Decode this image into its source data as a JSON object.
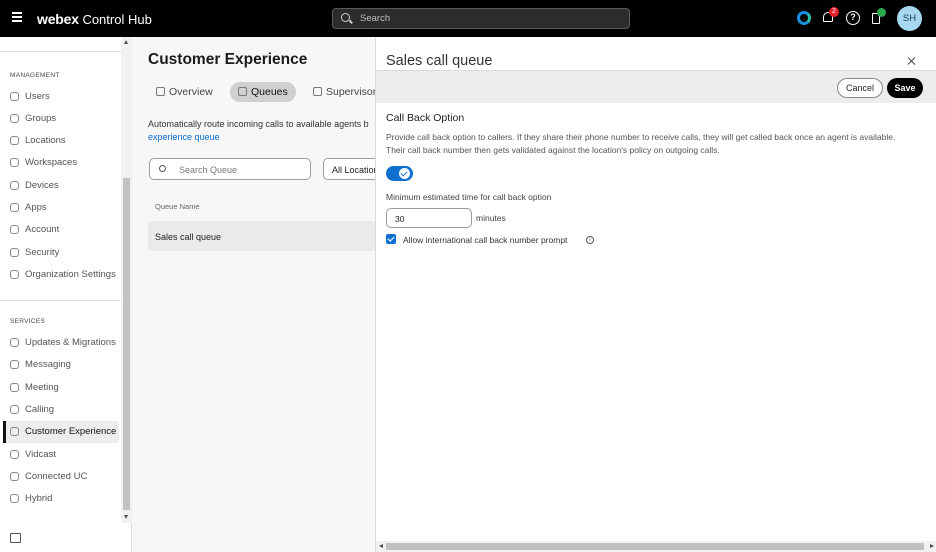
{
  "app": {
    "brand_bold": "webex",
    "brand_rest": "Control Hub"
  },
  "topbar": {
    "search_placeholder": "Search",
    "notifications_count": "2",
    "avatar_initials": "SH"
  },
  "sidebar": {
    "management_heading": "MANAGEMENT",
    "management_items": [
      {
        "label": "Users",
        "icon": "user-icon"
      },
      {
        "label": "Groups",
        "icon": "groups-icon"
      },
      {
        "label": "Locations",
        "icon": "location-icon"
      },
      {
        "label": "Workspaces",
        "icon": "workspace-icon"
      },
      {
        "label": "Devices",
        "icon": "device-icon"
      },
      {
        "label": "Apps",
        "icon": "apps-icon"
      },
      {
        "label": "Account",
        "icon": "account-icon"
      },
      {
        "label": "Security",
        "icon": "security-icon"
      },
      {
        "label": "Organization Settings",
        "icon": "settings-icon"
      }
    ],
    "services_heading": "SERVICES",
    "services_items": [
      {
        "label": "Updates & Migrations",
        "icon": "refresh-icon"
      },
      {
        "label": "Messaging",
        "icon": "message-icon"
      },
      {
        "label": "Meeting",
        "icon": "meeting-icon"
      },
      {
        "label": "Calling",
        "icon": "phone-icon"
      },
      {
        "label": "Customer Experience",
        "icon": "customer-experience-icon"
      },
      {
        "label": "Vidcast",
        "icon": "play-icon"
      },
      {
        "label": "Connected UC",
        "icon": "connected-uc-icon"
      },
      {
        "label": "Hybrid",
        "icon": "cloud-icon"
      }
    ]
  },
  "main": {
    "title": "Customer Experience",
    "tabs": [
      {
        "label": "Overview"
      },
      {
        "label": "Queues"
      },
      {
        "label": "Supervisor"
      }
    ],
    "description_line1": "Automatically route incoming calls to available agents b",
    "description_link": "experience queue",
    "search_placeholder": "Search Queue",
    "location_filter": "All Locations",
    "column_header": "Queue Name",
    "rows": [
      {
        "name": "Sales call queue"
      }
    ]
  },
  "panel": {
    "title": "Sales call queue",
    "cancel_label": "Cancel",
    "save_label": "Save",
    "section_title": "Call Back Option",
    "description": "Provide call back option to callers. If they share their phone number to receive calls, they will get called back once an agent is available. Their call back number then gets validated against the location's policy on outgoing calls.",
    "toggle_on": true,
    "min_time_label": "Minimum estimated time for call back option",
    "min_time_value": "30",
    "min_time_unit": "minutes",
    "intl_checkbox_checked": true,
    "intl_checkbox_label": "Allow international call back number prompt"
  },
  "colors": {
    "accent_blue": "#1170cf",
    "topbar_bg": "#000000",
    "notification_badge": "#e4212b",
    "avatar_bg": "#a8d8ef"
  }
}
